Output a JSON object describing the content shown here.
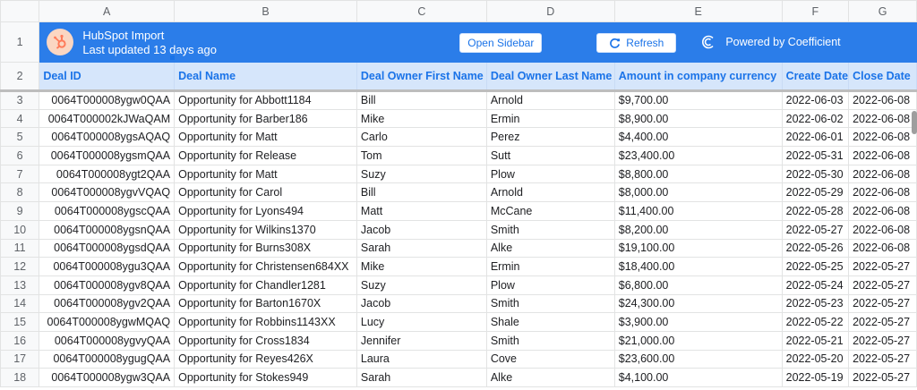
{
  "columns": [
    "A",
    "B",
    "C",
    "D",
    "E",
    "F",
    "G"
  ],
  "banner": {
    "title": "HubSpot Import",
    "subtitle": "Last updated 13 days ago",
    "open_sidebar": "Open Sidebar",
    "refresh": "Refresh",
    "powered_by": "Powered by Coefficient",
    "logo_icon": "hubspot-icon",
    "coefficient_icon": "coefficient-icon",
    "colors": {
      "bar": "#2b7de9",
      "logo_bg": "#fbd6c2",
      "logo_fg": "#ff7a59"
    }
  },
  "headers": [
    "Deal ID",
    "Deal Name",
    "Deal Owner First Name",
    "Deal Owner Last Name",
    "Amount in company currency",
    "Create Date",
    "Close Date"
  ],
  "row_numbers": [
    "1",
    "2",
    "3",
    "4",
    "5",
    "6",
    "7",
    "8",
    "9",
    "10",
    "11",
    "12",
    "13",
    "14",
    "15",
    "16",
    "17",
    "18"
  ],
  "rows": [
    [
      "0064T000008ygw0QAA",
      "Opportunity for Abbott1184",
      "Bill",
      "Arnold",
      "$9,700.00",
      "2022-06-03",
      "2022-06-08"
    ],
    [
      "0064T000002kJWaQAM",
      "Opportunity for Barber186",
      "Mike",
      "Ermin",
      "$8,900.00",
      "2022-06-02",
      "2022-06-08"
    ],
    [
      "0064T000008ygsAQAQ",
      "Opportunity for Matt",
      "Carlo",
      "Perez",
      "$4,400.00",
      "2022-06-01",
      "2022-06-08"
    ],
    [
      "0064T000008ygsmQAA",
      "Opportunity for Release",
      "Tom",
      "Sutt",
      "$23,400.00",
      "2022-05-31",
      "2022-06-08"
    ],
    [
      "0064T000008ygt2QAA",
      "Opportunity for Matt",
      "Suzy",
      "Plow",
      "$8,800.00",
      "2022-05-30",
      "2022-06-08"
    ],
    [
      "0064T000008ygvVQAQ",
      "Opportunity for Carol",
      "Bill",
      "Arnold",
      "$8,000.00",
      "2022-05-29",
      "2022-06-08"
    ],
    [
      "0064T000008ygscQAA",
      "Opportunity for Lyons494",
      "Matt",
      "McCane",
      "$11,400.00",
      "2022-05-28",
      "2022-06-08"
    ],
    [
      "0064T000008ygsnQAA",
      "Opportunity for Wilkins1370",
      "Jacob",
      "Smith",
      "$8,200.00",
      "2022-05-27",
      "2022-06-08"
    ],
    [
      "0064T000008ygsdQAA",
      "Opportunity for Burns308X",
      "Sarah",
      "Alke",
      "$19,100.00",
      "2022-05-26",
      "2022-06-08"
    ],
    [
      "0064T000008ygu3QAA",
      "Opportunity for Christensen684XX",
      "Mike",
      "Ermin",
      "$18,400.00",
      "2022-05-25",
      "2022-05-27"
    ],
    [
      "0064T000008ygv8QAA",
      "Opportunity for Chandler1281",
      "Suzy",
      "Plow",
      "$6,800.00",
      "2022-05-24",
      "2022-05-27"
    ],
    [
      "0064T000008ygv2QAA",
      "Opportunity for Barton1670X",
      "Jacob",
      "Smith",
      "$24,300.00",
      "2022-05-23",
      "2022-05-27"
    ],
    [
      "0064T000008ygwMQAQ",
      "Opportunity for Robbins1143XX",
      "Lucy",
      "Shale",
      "$3,900.00",
      "2022-05-22",
      "2022-05-27"
    ],
    [
      "0064T000008ygvyQAA",
      "Opportunity for Cross1834",
      "Jennifer",
      "Smith",
      "$21,000.00",
      "2022-05-21",
      "2022-05-27"
    ],
    [
      "0064T000008ygugQAA",
      "Opportunity for Reyes426X",
      "Laura",
      "Cove",
      "$23,600.00",
      "2022-05-20",
      "2022-05-27"
    ],
    [
      "0064T000008ygw3QAA",
      "Opportunity for Stokes949",
      "Sarah",
      "Alke",
      "$4,100.00",
      "2022-05-19",
      "2022-05-27"
    ]
  ]
}
